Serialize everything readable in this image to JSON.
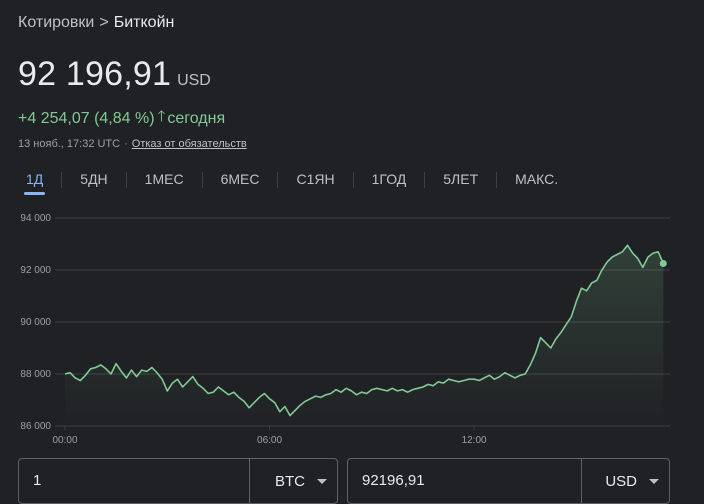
{
  "breadcrumb": {
    "parent": "Котировки",
    "separator": ">",
    "current": "Биткойн"
  },
  "price": {
    "value": "92 196,91",
    "currency": "USD"
  },
  "change": {
    "text": "+4 254,07 (4,84 %)",
    "period": "сегодня"
  },
  "meta": {
    "timestamp": "13 нояб., 17:32 UTC",
    "separator": "·",
    "disclaimer": "Отказ от обязательств"
  },
  "tabs": [
    {
      "label": "1Д",
      "active": true
    },
    {
      "label": "5ДН"
    },
    {
      "label": "1МЕС"
    },
    {
      "label": "6МЕС"
    },
    {
      "label": "С1ЯН"
    },
    {
      "label": "1ГОД"
    },
    {
      "label": "5ЛЕТ"
    },
    {
      "label": "МАКС."
    }
  ],
  "colors": {
    "line": "#81c995",
    "grid": "#3c4043",
    "accent": "#8ab4f8"
  },
  "chart_data": {
    "type": "line",
    "ylim": [
      86000,
      94000
    ],
    "yticks": [
      {
        "value": 94000,
        "label": "94 000"
      },
      {
        "value": 92000,
        "label": "92 000"
      },
      {
        "value": 90000,
        "label": "90 000"
      },
      {
        "value": 88000,
        "label": "88 000"
      },
      {
        "value": 86000,
        "label": "86 000"
      }
    ],
    "xlim": [
      0,
      17.6
    ],
    "xticks": [
      {
        "value": 0,
        "label": "00:00"
      },
      {
        "value": 6,
        "label": "06:00"
      },
      {
        "value": 12,
        "label": "12:00"
      }
    ],
    "series": [
      {
        "x": [
          0,
          0.15,
          0.3,
          0.45,
          0.6,
          0.75,
          0.9,
          1.05,
          1.2,
          1.35,
          1.5,
          1.65,
          1.8,
          1.95,
          2.1,
          2.25,
          2.4,
          2.55,
          2.7,
          2.85,
          3.0,
          3.15,
          3.3,
          3.45,
          3.6,
          3.75,
          3.9,
          4.05,
          4.2,
          4.35,
          4.5,
          4.65,
          4.8,
          4.95,
          5.1,
          5.25,
          5.4,
          5.55,
          5.7,
          5.85,
          6.0,
          6.15,
          6.3,
          6.45,
          6.6,
          6.75,
          6.9,
          7.05,
          7.2,
          7.35,
          7.5,
          7.65,
          7.8,
          7.95,
          8.1,
          8.25,
          8.4,
          8.55,
          8.7,
          8.85,
          9.0,
          9.15,
          9.3,
          9.45,
          9.6,
          9.75,
          9.9,
          10.05,
          10.2,
          10.35,
          10.5,
          10.65,
          10.8,
          10.95,
          11.1,
          11.25,
          11.4,
          11.55,
          11.7,
          11.85,
          12.0,
          12.15,
          12.3,
          12.45,
          12.6,
          12.75,
          12.9,
          13.05,
          13.2,
          13.35,
          13.5,
          13.65,
          13.8,
          13.95,
          14.1,
          14.25,
          14.4,
          14.55,
          14.7,
          14.85,
          15.0,
          15.15,
          15.3,
          15.45,
          15.6,
          15.75,
          15.9,
          16.05,
          16.2,
          16.35,
          16.5,
          16.65,
          16.8,
          16.95,
          17.1,
          17.25,
          17.4,
          17.55
        ],
        "values": [
          88000,
          88050,
          87850,
          87750,
          87950,
          88200,
          88250,
          88350,
          88200,
          88000,
          88400,
          88100,
          87850,
          88150,
          87900,
          88150,
          88100,
          88250,
          88050,
          87800,
          87350,
          87650,
          87800,
          87500,
          87700,
          87900,
          87600,
          87450,
          87250,
          87300,
          87500,
          87350,
          87200,
          87300,
          87100,
          86950,
          86700,
          86900,
          87100,
          87250,
          87050,
          86900,
          86550,
          86750,
          86400,
          86600,
          86800,
          86950,
          87050,
          87150,
          87100,
          87200,
          87250,
          87400,
          87300,
          87450,
          87350,
          87200,
          87300,
          87250,
          87400,
          87450,
          87400,
          87350,
          87450,
          87350,
          87400,
          87300,
          87400,
          87450,
          87500,
          87600,
          87550,
          87700,
          87650,
          87800,
          87750,
          87700,
          87750,
          87800,
          87800,
          87750,
          87850,
          87950,
          87800,
          87900,
          88050,
          87950,
          87850,
          87950,
          88000,
          88350,
          88800,
          89400,
          89200,
          89000,
          89350,
          89600,
          89900,
          90200,
          90800,
          91300,
          91200,
          91500,
          91600,
          92000,
          92300,
          92500,
          92600,
          92700,
          92950,
          92650,
          92450,
          92100,
          92500,
          92650,
          92700,
          92250
        ]
      }
    ]
  },
  "converter": {
    "from_value": "1",
    "from_currency": "BTC",
    "to_value": "92196,91",
    "to_currency": "USD"
  }
}
